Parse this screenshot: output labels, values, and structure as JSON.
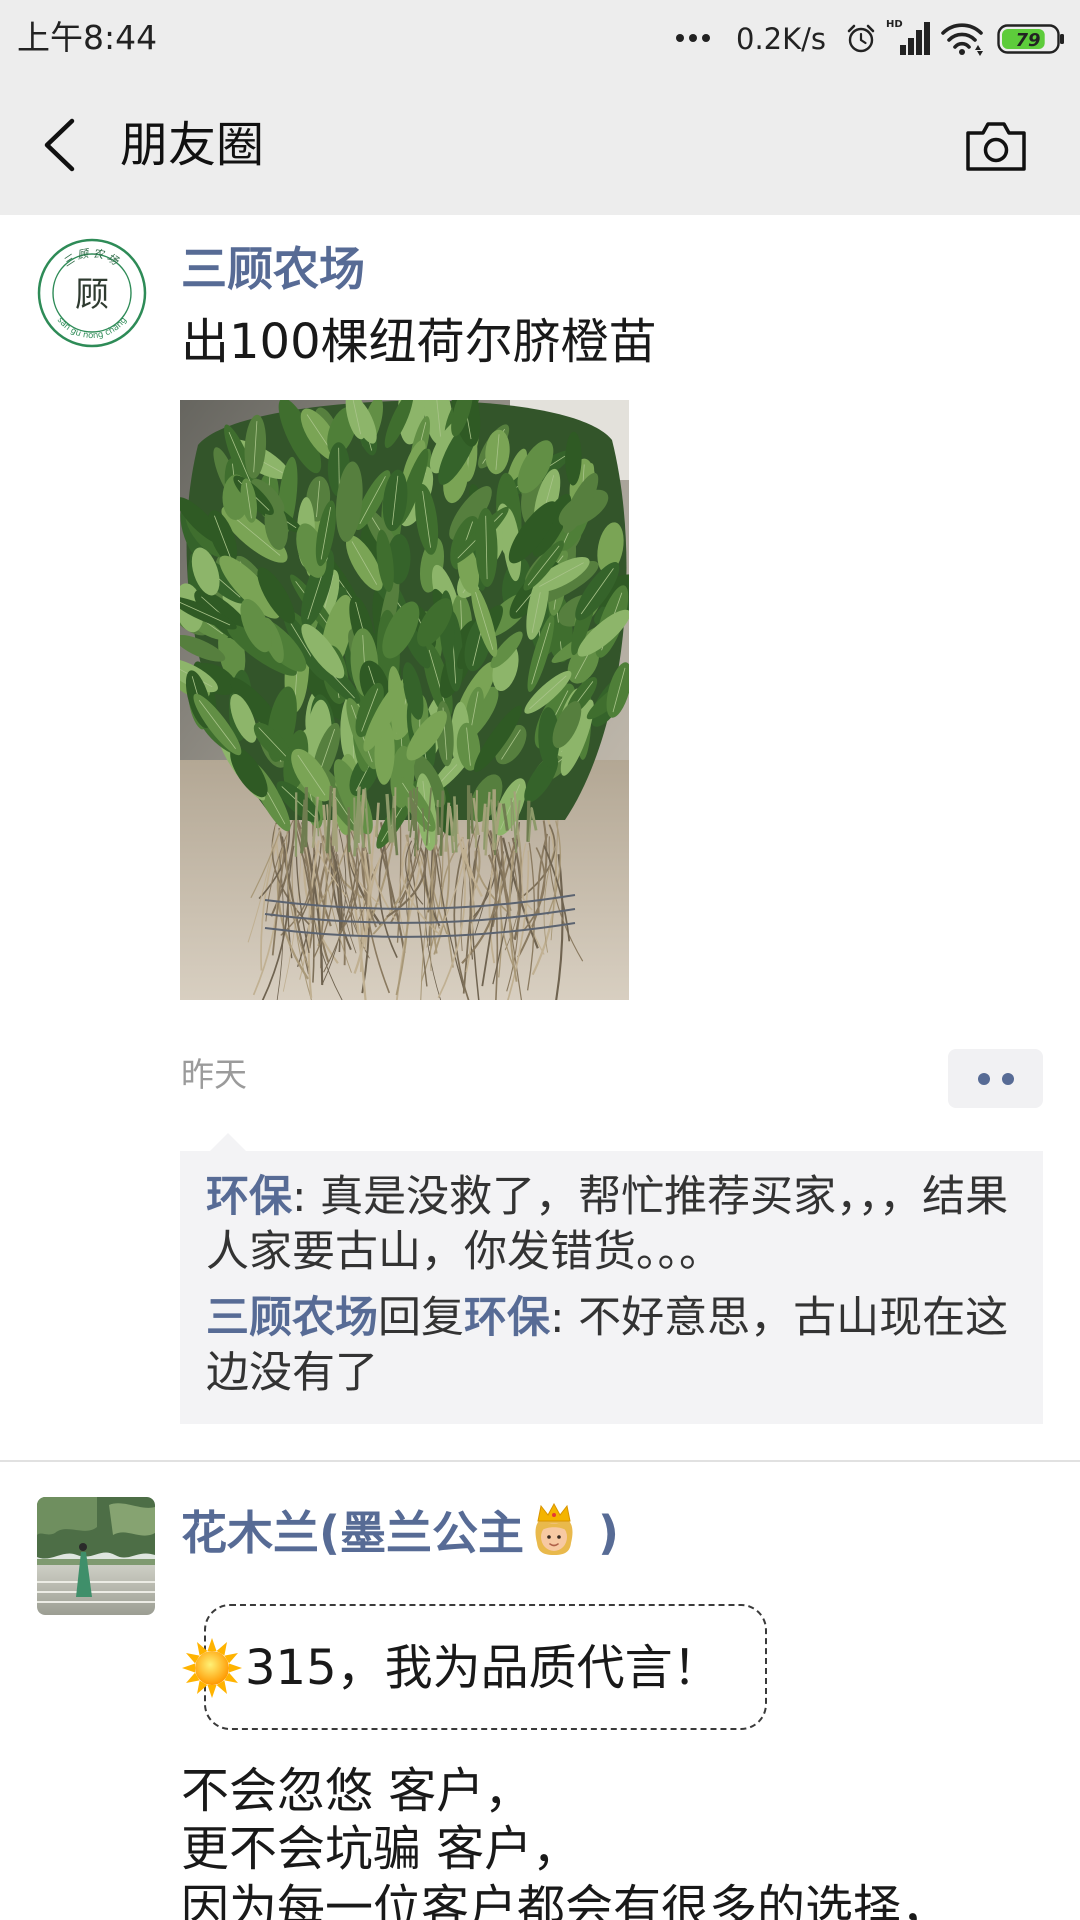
{
  "status_bar": {
    "time": "上午8:44",
    "network_speed": "0.2K/s",
    "hd_label": "HD",
    "battery_level": 79,
    "battery_label": "79",
    "battery_color": "#5dcc3b",
    "icons": {
      "overflow": "more-dots-icon",
      "alarm": "alarm-clock-icon",
      "signal": "hd-signal-icon",
      "wifi": "wifi-icon",
      "battery": "battery-icon"
    }
  },
  "header": {
    "title": "朋友圈",
    "back_icon": "back-chevron-icon",
    "camera_icon": "camera-icon"
  },
  "colors": {
    "bar_background": "#ededed",
    "name_link": "#576b95",
    "body_text": "#191919",
    "meta_text": "#9b9b9b",
    "comment_background": "#f3f3f5",
    "divider": "#e1e1e1"
  },
  "posts": [
    {
      "author": "三顾农场",
      "avatar": {
        "icon": "farm-logo-avatar",
        "logo_top_text": "三顾农场",
        "logo_center_text": "顾",
        "logo_bottom_text": "san gu nong chang",
        "logo_color": "#2e8b57"
      },
      "text": "出100棵纽荷尔脐橙苗",
      "image": {
        "icon": "orange-seedling-bundle-photo"
      },
      "time": "昨天",
      "more_icon": "more-actions-icon",
      "comments": [
        {
          "author": "环保",
          "separator": ": ",
          "text": "真是没救了，帮忙推荐买家，，，结果人家要古山，你发错货。。。"
        },
        {
          "author": "三顾农场",
          "reply_word": "回复",
          "reply_to": "环保",
          "separator": ": ",
          "text": "不好意思，古山现在这边没有了"
        }
      ]
    },
    {
      "author_prefix": "花木兰(墨兰公主",
      "author_emoji_icon": "princess-emoji-icon",
      "author_suffix": " )",
      "avatar": {
        "icon": "garden-photo-avatar"
      },
      "highlight": {
        "emoji_icon": "sun-emoji-icon",
        "text": "315，我为品质代言！"
      },
      "lines": [
        "不会忽悠 客户，",
        "更不会坑骗 客户，",
        "因为每一位客户都会有很多的选择，"
      ]
    }
  ]
}
